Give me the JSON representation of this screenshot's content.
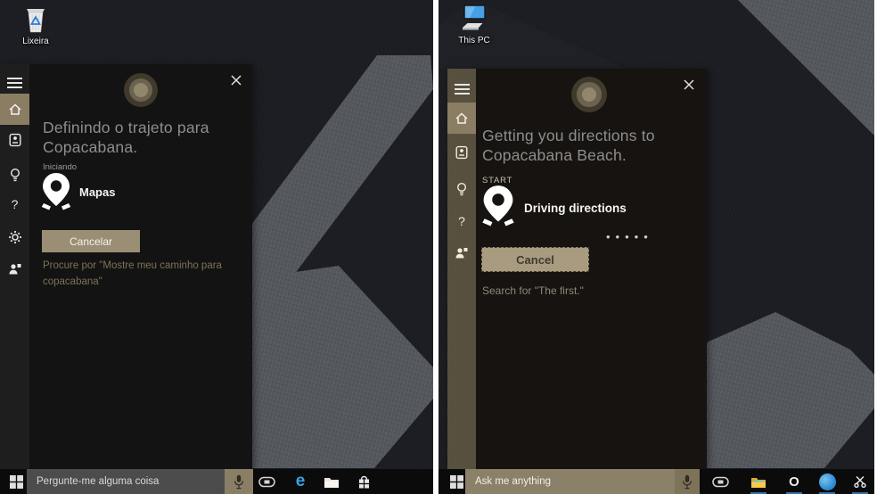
{
  "left_shot": {
    "desktop": {
      "recycle_bin_label": "Lixeira"
    },
    "cortana": {
      "title_line1": "Definindo o trajeto para",
      "title_line2": "Copacabana.",
      "status_label": "Iniciando",
      "route_app": "Mapas",
      "cancel_button": "Cancelar",
      "hint": "Procure por \"Mostre meu caminho para copacabana\""
    },
    "taskbar": {
      "search_placeholder": "Pergunte-me alguma coisa"
    }
  },
  "right_shot": {
    "desktop": {
      "this_pc_label": "This PC"
    },
    "cortana": {
      "title_line1": "Getting you directions to",
      "title_line2": "Copacabana Beach.",
      "status_label": "START",
      "route_app": "Driving directions",
      "progress_dots": "•••••",
      "cancel_button": "Cancel",
      "hint": "Search for \"The first.\""
    },
    "taskbar": {
      "search_placeholder": "Ask me anything"
    }
  },
  "glyphs": {
    "edge": "e",
    "opera": "O",
    "help": "?"
  },
  "colors": {
    "accent_tan": "#8a7d63",
    "button_tan_left": "#9a8e74",
    "button_tan_right": "#a89b7f",
    "edge_blue": "#3aa4dc",
    "orb_core": "#91876a",
    "taskbar_black": "#0b0b0b",
    "wallpaper_gray": "#54575d"
  }
}
